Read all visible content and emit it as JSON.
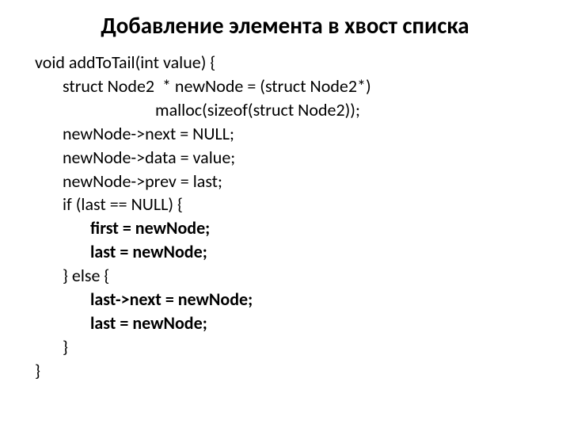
{
  "title": "Добавление элемента в хвост списка",
  "code": {
    "l1": "void addToTail(int value) {",
    "l2": "struct Node2  * newNode = (struct Node2*)",
    "l3": "malloc(sizeof(struct Node2));",
    "l4": "newNode->next = NULL;",
    "l5": "newNode->data = value;",
    "l6": "newNode->prev = last;",
    "l7": "",
    "l8": "if (last == NULL) {",
    "l9": "first = newNode;",
    "l10": "last = newNode;",
    "l11": "} else {",
    "l12": "last->next = newNode;",
    "l13": "last = newNode;",
    "l14": "}",
    "l15": "}"
  }
}
